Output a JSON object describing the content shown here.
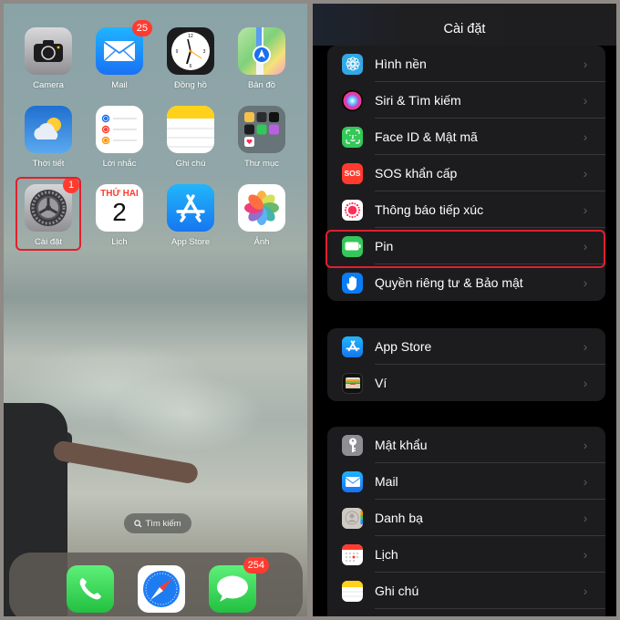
{
  "home_screen": {
    "apps": [
      {
        "name": "Camera",
        "badge": null
      },
      {
        "name": "Mail",
        "badge": "25"
      },
      {
        "name": "Đồng hồ",
        "badge": null
      },
      {
        "name": "Bản đồ",
        "badge": null
      },
      {
        "name": "Thời tiết",
        "badge": null
      },
      {
        "name": "Lời nhắc",
        "badge": null
      },
      {
        "name": "Ghi chú",
        "badge": null
      },
      {
        "name": "Thư mục",
        "badge": null
      },
      {
        "name": "Cài đặt",
        "badge": "1"
      },
      {
        "name": "Lịch",
        "badge": null,
        "weekday": "THỨ HAI",
        "day": "2"
      },
      {
        "name": "App Store",
        "badge": null
      },
      {
        "name": "Ảnh",
        "badge": null
      }
    ],
    "search_pill": {
      "icon": "search-icon",
      "label": "Tìm kiếm"
    },
    "dock": [
      {
        "name": "Phone",
        "icon": "phone-icon",
        "badge": null
      },
      {
        "name": "Safari",
        "icon": "compass-icon",
        "badge": null
      },
      {
        "name": "Messages",
        "icon": "message-bubble-icon",
        "badge": "254"
      }
    ],
    "highlight": "Cài đặt"
  },
  "settings": {
    "title": "Cài đặt",
    "groups": [
      {
        "items": [
          {
            "label": "Hình nền",
            "icon": "wallpaper-flower-icon",
            "color": "#32a8e6"
          },
          {
            "label": "Siri & Tìm kiếm",
            "icon": "siri-icon",
            "color": "#2a1b3d"
          },
          {
            "label": "Face ID & Mật mã",
            "icon": "face-id-icon",
            "color": "#34c759"
          },
          {
            "label": "SOS khẩn cấp",
            "icon": "sos-icon",
            "color": "#ff3b30"
          },
          {
            "label": "Thông báo tiếp xúc",
            "icon": "exposure-notification-icon",
            "color": "#ffffff"
          },
          {
            "label": "Pin",
            "icon": "battery-icon",
            "color": "#34c759"
          },
          {
            "label": "Quyền riêng tư & Bảo mật",
            "icon": "hand-icon",
            "color": "#0a7cf5"
          }
        ]
      },
      {
        "items": [
          {
            "label": "App Store",
            "icon": "app-store-icon",
            "color": "#1e90ff"
          },
          {
            "label": "Ví",
            "icon": "wallet-icon",
            "color": "#1c1c1e"
          }
        ]
      },
      {
        "items": [
          {
            "label": "Mật khẩu",
            "icon": "key-icon",
            "color": "#8e8e93"
          },
          {
            "label": "Mail",
            "icon": "mail-icon",
            "color": "#1e90ff"
          },
          {
            "label": "Danh bạ",
            "icon": "contacts-icon",
            "color": "#cfcbc4"
          },
          {
            "label": "Lịch",
            "icon": "calendar-icon",
            "color": "#ffffff"
          },
          {
            "label": "Ghi chú",
            "icon": "notes-icon",
            "color": "#ffffff"
          }
        ]
      }
    ],
    "highlight": "Pin"
  }
}
